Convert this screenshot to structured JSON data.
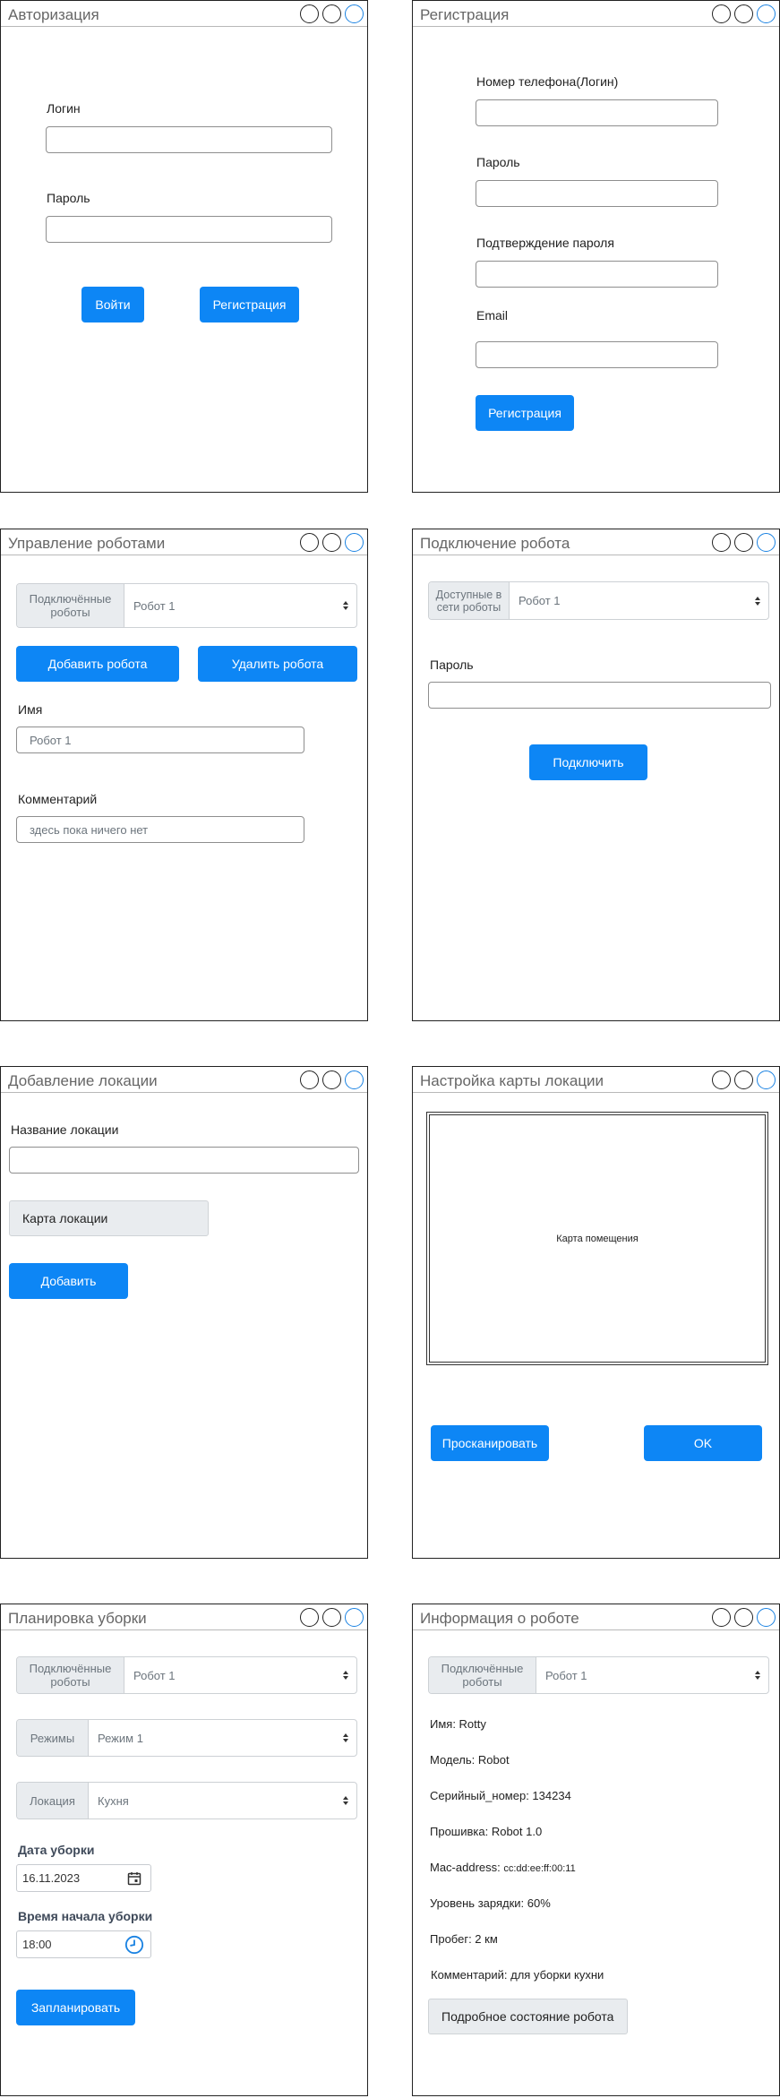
{
  "auth": {
    "title": "Авторизация",
    "login_label": "Логин",
    "login_value": "",
    "password_label": "Пароль",
    "password_value": "",
    "login_button": "Войти",
    "register_button": "Регистрация"
  },
  "registration": {
    "title": "Регистрация",
    "phone_label": "Номер телефона(Логин)",
    "phone_value": "",
    "password_label": "Пароль",
    "password_value": "",
    "confirm_label": "Подтверждение пароля",
    "confirm_value": "",
    "email_label": "Email",
    "email_value": "",
    "submit_button": "Регистрация"
  },
  "robot_management": {
    "title": "Управление роботами",
    "connected_addon": "Подключённые роботы",
    "connected_selected": "Робот 1",
    "add_button": "Добавить робота",
    "delete_button": "Удалить робота",
    "name_label": "Имя",
    "name_value": "Робот 1",
    "comment_label": "Комментарий",
    "comment_value": "здесь пока ничего нет"
  },
  "robot_connect": {
    "title": "Подключение робота",
    "available_addon": "Доступные в сети роботы",
    "available_selected": "Робот 1",
    "password_label": "Пароль",
    "password_value": "",
    "connect_button": "Подключить"
  },
  "add_location": {
    "title": "Добавление локации",
    "name_label": "Название локации",
    "name_value": "",
    "map_button": "Карта локации",
    "add_button": "Добавить"
  },
  "location_map": {
    "title": "Настройка карты локации",
    "map_placeholder": "Карта помещения",
    "scan_button": "Просканировать",
    "ok_button": "OK"
  },
  "cleaning_schedule": {
    "title": "Планировка уборки",
    "robots_addon": "Подключённые роботы",
    "robots_selected": "Робот 1",
    "modes_addon": "Режимы",
    "modes_selected": "Режим 1",
    "location_addon": "Локация",
    "location_selected": "Кухня",
    "date_label": "Дата уборки",
    "date_value": "16.11.2023",
    "time_label": "Время начала уборки",
    "time_value": "18:00",
    "schedule_button": "Запланировать"
  },
  "robot_info": {
    "title": "Информация о роботе",
    "robots_addon": "Подключённые роботы",
    "robots_selected": "Робот 1",
    "name": "Имя: Rotty",
    "model": "Модель: Robot",
    "serial": "Серийный_номер: 134234",
    "firmware": "Прошивка: Robot 1.0",
    "mac_label": "Mac-address: ",
    "mac_value": "cc:dd:ee:ff:00:11",
    "battery": "Уровень зарядки: 60%",
    "mileage": "Пробег: 2 км",
    "comment": "Комментарий: для уборки кухни",
    "details_button": "Подробное состояние робота"
  },
  "colors": {
    "primary": "#0d86f5",
    "addon_bg": "#e9ecef",
    "accent_control": "#1a82e2"
  },
  "icons": {
    "window_controls": "circle-icon",
    "select_caret": "sort-arrows-icon",
    "date_picker": "calendar-icon",
    "time_picker": "clock-icon"
  }
}
